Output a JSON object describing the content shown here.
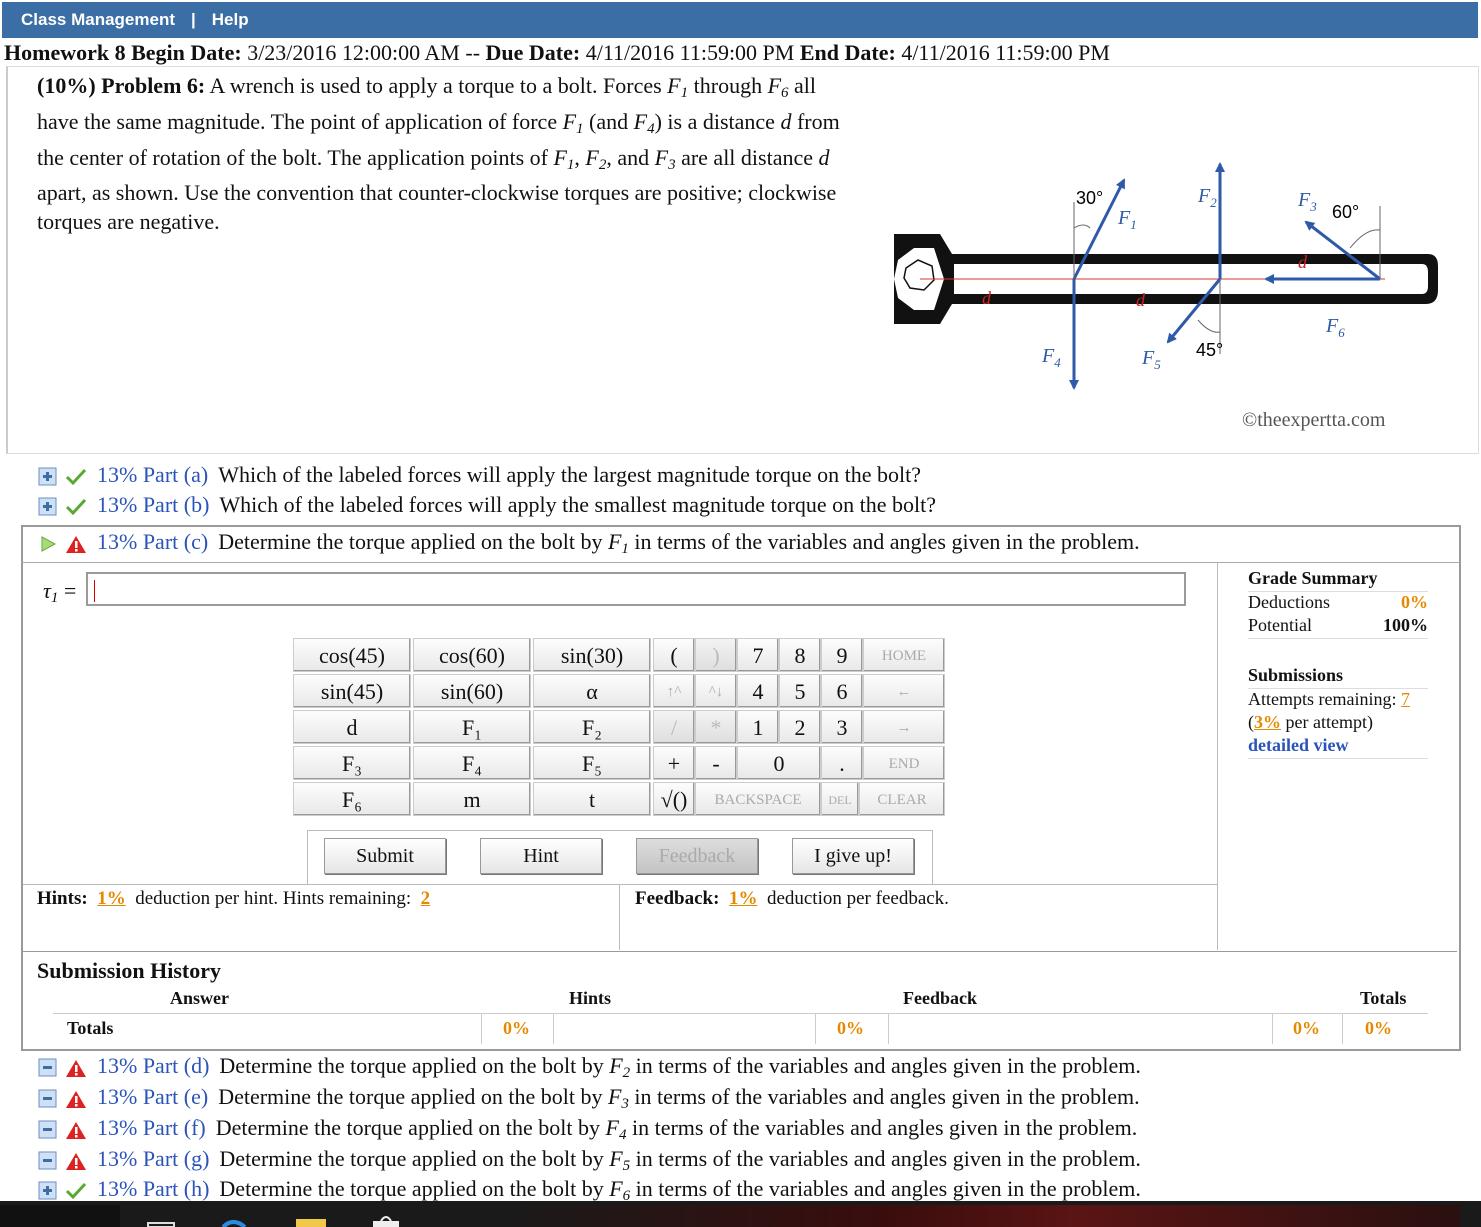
{
  "nav": {
    "class_management": "Class Management",
    "separator": "|",
    "help": "Help"
  },
  "homework": {
    "title": "Homework 8 Begin Date:",
    "begin": "3/23/2016 12:00:00 AM",
    "dash": "--",
    "due_label": "Due Date:",
    "due": "4/11/2016 11:59:00 PM",
    "end_label": "End Date:",
    "end": "4/11/2016 11:59:00 PM"
  },
  "problem": {
    "heading": "(10%) Problem 6:",
    "line1": "A wrench is used to apply a torque to a bolt. Forces F",
    "text_html_parts": [
      "A wrench is used to apply a torque to a bolt. Forces ",
      " through ",
      " all have the same magnitude. The point of application of force ",
      " (and ",
      ") is a distance ",
      " from the center of rotation of the bolt. The application points of ",
      ", ",
      ", and ",
      " are all distance ",
      " apart, as shown. Use the convention that counter-clockwise torques are positive; clockwise torques are negative."
    ],
    "figure": {
      "angle1": "30°",
      "angle2": "60°",
      "angle3": "45°",
      "labels": [
        "F1",
        "F2",
        "F3",
        "F4",
        "F5",
        "F6"
      ],
      "distance": "d",
      "watermark": "©theexpertta.com"
    }
  },
  "parts": [
    {
      "id": "a",
      "status": "correct",
      "label": "13% Part (a)",
      "text": "Which of the labeled forces will apply the largest magnitude torque on the bolt?"
    },
    {
      "id": "b",
      "status": "correct",
      "label": "13% Part (b)",
      "text": "Which of the labeled forces will apply the smallest magnitude torque on the bolt?"
    },
    {
      "id": "c",
      "status": "active",
      "label": "13% Part (c)",
      "text_pre": "Determine the torque applied on the bolt by ",
      "force": "F",
      "force_sub": "1",
      "text_post": " in terms of the variables and angles given in the problem."
    },
    {
      "id": "d",
      "status": "warning",
      "label": "13% Part (d)",
      "text_pre": "Determine the torque applied on the bolt by ",
      "force": "F",
      "force_sub": "2",
      "text_post": " in terms of the variables and angles given in the problem."
    },
    {
      "id": "e",
      "status": "warning",
      "label": "13% Part (e)",
      "text_pre": "Determine the torque applied on the bolt by ",
      "force": "F",
      "force_sub": "3",
      "text_post": " in terms of the variables and angles given in the problem."
    },
    {
      "id": "f",
      "status": "warning",
      "label": "13% Part (f)",
      "text_pre": "Determine the torque applied on the bolt by ",
      "force": "F",
      "force_sub": "4",
      "text_post": " in terms of the variables and angles given in the problem."
    },
    {
      "id": "g",
      "status": "warning",
      "label": "13% Part (g)",
      "text_pre": "Determine the torque applied on the bolt by ",
      "force": "F",
      "force_sub": "5",
      "text_post": " in terms of the variables and angles given in the problem."
    },
    {
      "id": "h",
      "status": "correct",
      "label": "13% Part (h)",
      "text_pre": "Determine the torque applied on the bolt by ",
      "force": "F",
      "force_sub": "6",
      "text_post": " in terms of the variables and angles given in the problem."
    }
  ],
  "answer": {
    "variable": "τ",
    "variable_sub": "1",
    "equals": "=",
    "value": ""
  },
  "keypad": {
    "functions": [
      [
        "cos(45)",
        "cos(60)",
        "sin(30)"
      ],
      [
        "sin(45)",
        "sin(60)",
        "α"
      ],
      [
        "d",
        "F₁",
        "F₂"
      ],
      [
        "F₃",
        "F₄",
        "F₅"
      ],
      [
        "F₆",
        "m",
        "t"
      ]
    ],
    "ops": [
      "(",
      ")",
      "↑^",
      "^↓",
      "/",
      "*",
      "+",
      "-",
      "√()"
    ],
    "digits": [
      "7",
      "8",
      "9",
      "4",
      "5",
      "6",
      "1",
      "2",
      "3",
      "0",
      "."
    ],
    "controls": {
      "home": "HOME",
      "left": "←",
      "right": "→",
      "end": "END",
      "backspace": "BACKSPACE",
      "del": "DEL",
      "clear": "CLEAR"
    }
  },
  "actions": {
    "submit": "Submit",
    "hint": "Hint",
    "feedback": "Feedback",
    "give_up": "I give up!"
  },
  "hints": {
    "label": "Hints:",
    "deduction": "1%",
    "text": "deduction per hint. Hints remaining:",
    "remaining": "2"
  },
  "feedback": {
    "label": "Feedback:",
    "deduction": "1%",
    "text": "deduction per feedback."
  },
  "grade_summary": {
    "title": "Grade Summary",
    "deductions_label": "Deductions",
    "deductions": "0%",
    "potential_label": "Potential",
    "potential": "100%",
    "submissions_title": "Submissions",
    "attempts_label": "Attempts remaining:",
    "attempts": "7",
    "per_attempt_pct": "3%",
    "per_attempt_text": "per attempt)",
    "open_paren": "(",
    "detailed_view": "detailed view"
  },
  "history": {
    "title": "Submission History",
    "columns": [
      "Answer",
      "Hints",
      "Feedback",
      "Totals"
    ],
    "totals_label": "Totals",
    "totals": [
      "0%",
      "0%",
      "0%",
      "0%"
    ]
  }
}
